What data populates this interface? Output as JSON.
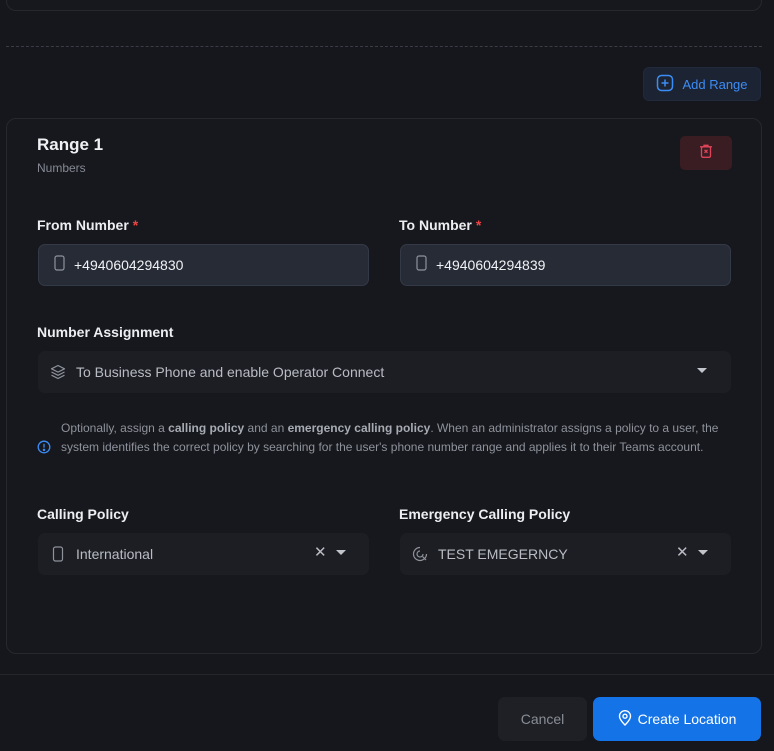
{
  "add_range": {
    "label": "Add Range",
    "icon": "plus-square-icon"
  },
  "range": {
    "title": "Range 1",
    "subtitle": "Numbers",
    "delete_icon": "trash-icon",
    "from": {
      "label": "From Number",
      "required": "*",
      "value": "+4940604294830",
      "icon": "phone-icon"
    },
    "to": {
      "label": "To Number",
      "required": "*",
      "value": "+4940604294839",
      "icon": "phone-icon"
    },
    "assignment": {
      "label": "Number Assignment",
      "value": "To Business Phone and enable Operator Connect",
      "icon": "layers-icon"
    },
    "info": {
      "icon": "info-circle-icon",
      "t1": "Optionally, assign a ",
      "b1": "calling policy",
      "t2": " and an ",
      "b2": "emergency calling policy",
      "t3": ". When an administrator assigns a policy to a user, the system identifies the correct policy by searching for the user's phone number range and applies it to their Teams account."
    },
    "calling_policy": {
      "label": "Calling Policy",
      "value": "International",
      "clear": "✕",
      "icon": "phone-icon"
    },
    "emergency_policy": {
      "label": "Emergency Calling Policy",
      "value": "TEST EMEGERNCY",
      "clear": "✕",
      "icon": "emergency-icon"
    }
  },
  "footer": {
    "cancel_label": "Cancel",
    "create_label": "Create Location",
    "create_icon": "map-pin-icon"
  },
  "colors": {
    "accent": "#1473e6",
    "link": "#3b8cf6",
    "danger": "#ef4444"
  }
}
